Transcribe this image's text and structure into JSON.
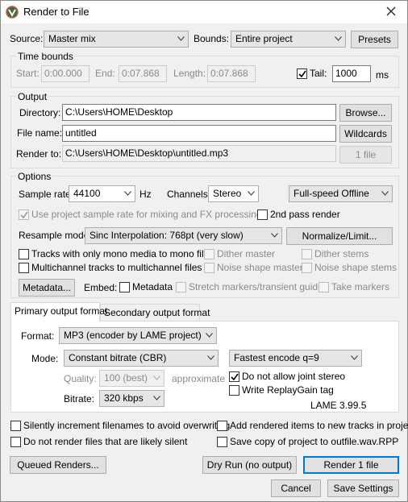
{
  "window": {
    "title": "Render to File"
  },
  "source": {
    "label": "Source:",
    "value": "Master mix"
  },
  "bounds": {
    "label": "Bounds:",
    "value": "Entire project"
  },
  "presets_label": "Presets",
  "time_bounds": {
    "title": "Time bounds",
    "start_label": "Start:",
    "start_value": "0:00.000",
    "end_label": "End:",
    "end_value": "0:07.868",
    "length_label": "Length:",
    "length_value": "0:07.868",
    "tail_label": "Tail:",
    "tail_value": "1000",
    "tail_unit": "ms"
  },
  "output": {
    "title": "Output",
    "directory_label": "Directory:",
    "directory_value": "C:\\Users\\HOME\\Desktop",
    "browse_label": "Browse...",
    "filename_label": "File name:",
    "filename_value": "untitled",
    "wildcards_label": "Wildcards",
    "render_to_label": "Render to:",
    "render_to_value": "C:\\Users\\HOME\\Desktop\\untitled.mp3",
    "file_count": "1 file"
  },
  "options": {
    "title": "Options",
    "sample_rate_label": "Sample rate:",
    "sample_rate_value": "44100",
    "sample_rate_unit": "Hz",
    "channels_label": "Channels:",
    "channels_value": "Stereo",
    "speed_value": "Full-speed Offline",
    "use_project_rate": "Use project sample rate for mixing and FX processing",
    "second_pass": "2nd pass render",
    "resample_label": "Resample mode:",
    "resample_value": "Sinc Interpolation: 768pt (very slow)",
    "normalize_label": "Normalize/Limit...",
    "mono_tracks": "Tracks with only mono media to mono file",
    "dither_master": "Dither master",
    "dither_stems": "Dither stems",
    "multichannel": "Multichannel tracks to multichannel files",
    "noise_master": "Noise shape master",
    "noise_stems": "Noise shape stems",
    "metadata_button": "Metadata...",
    "embed_label": "Embed:",
    "metadata_check": "Metadata",
    "stretch_markers": "Stretch markers/transient guides",
    "take_markers": "Take markers"
  },
  "tabs": {
    "primary": "Primary output format",
    "secondary": "Secondary output format"
  },
  "format": {
    "format_label": "Format:",
    "format_value": "MP3 (encoder by LAME project)",
    "mode_label": "Mode:",
    "mode_value": "Constant bitrate  (CBR)",
    "encode_value": "Fastest encode q=9",
    "quality_label": "Quality:",
    "quality_value": "100 (best)",
    "quality_hint": "approximate",
    "no_joint_stereo": "Do not allow joint stereo",
    "bitrate_label": "Bitrate:",
    "bitrate_value": "320 kbps",
    "replaygain": "Write ReplayGain tag",
    "lame_version": "LAME 3.99.5"
  },
  "bottom_options": {
    "increment": "Silently increment filenames to avoid overwriting",
    "add_tracks": "Add rendered items to new tracks in project",
    "no_silent": "Do not render files that are likely silent",
    "save_copy": "Save copy of project to outfile.wav.RPP"
  },
  "buttons": {
    "queued": "Queued Renders...",
    "dry_run": "Dry Run (no output)",
    "render": "Render 1 file",
    "cancel": "Cancel",
    "save_settings": "Save Settings"
  }
}
